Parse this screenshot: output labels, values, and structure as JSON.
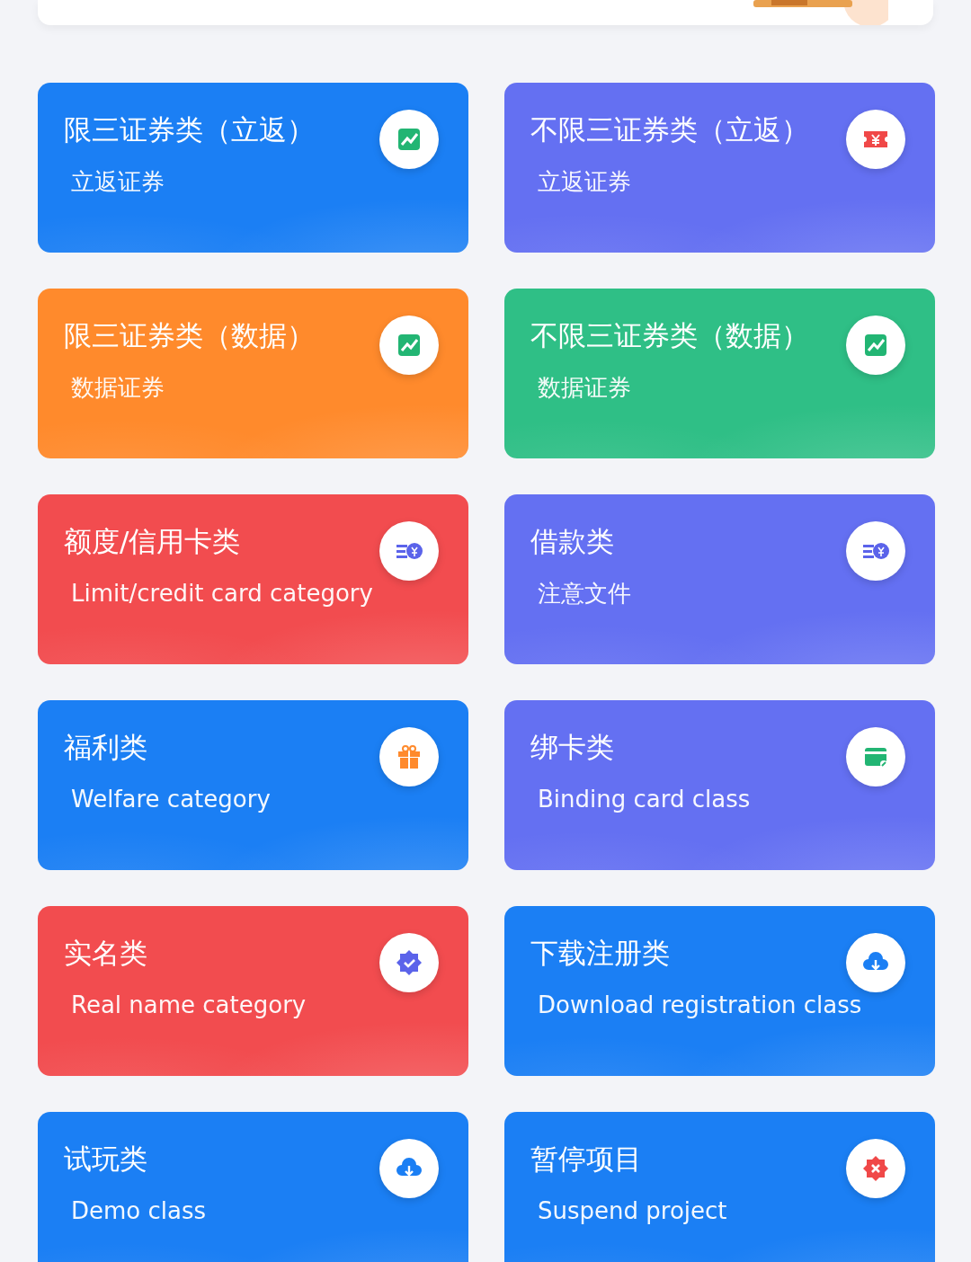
{
  "cards": [
    {
      "title": "限三证券类（立返）",
      "subtitle": "立返证券",
      "color": "#1b7ff4"
    },
    {
      "title": "不限三证券类（立返）",
      "subtitle": "立返证券",
      "color": "#6470f2"
    },
    {
      "title": "限三证券类（数据）",
      "subtitle": "数据证券",
      "color": "#ff8a2c"
    },
    {
      "title": "不限三证券类（数据）",
      "subtitle": "数据证券",
      "color": "#2fbf86"
    },
    {
      "title": "额度/信用卡类",
      "subtitle": "Limit/credit card category",
      "color": "#f24c4f"
    },
    {
      "title": "借款类",
      "subtitle": "注意文件",
      "color": "#6470f2"
    },
    {
      "title": "福利类",
      "subtitle": "Welfare category",
      "color": "#1b7ff4"
    },
    {
      "title": "绑卡类",
      "subtitle": "Binding card class",
      "color": "#6470f2"
    },
    {
      "title": "实名类",
      "subtitle": "Real name category",
      "color": "#f24c4f"
    },
    {
      "title": "下载注册类",
      "subtitle": "Download registration class",
      "color": "#1b7ff4"
    },
    {
      "title": "试玩类",
      "subtitle": "Demo class",
      "color": "#1b7ff4"
    },
    {
      "title": "暂停项目",
      "subtitle": "Suspend project",
      "color": "#1b7ff4"
    }
  ]
}
